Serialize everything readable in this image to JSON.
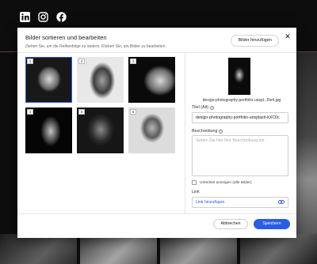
{
  "social": [
    {
      "icon": "linkedin-icon"
    },
    {
      "icon": "instagram-icon"
    },
    {
      "icon": "facebook-icon"
    }
  ],
  "modal": {
    "title": "Bilder sortieren und bearbeiten",
    "subtitle": "Ziehen Sie, um die Reihenfolge zu ändern. Klicken Sie, um Bilder zu bearbeiten.",
    "add_label": "Bilder hinzufügen",
    "close_label": "✕"
  },
  "thumbnails": [
    {
      "num": "1",
      "selected": true
    },
    {
      "num": "2",
      "selected": false
    },
    {
      "num": "3",
      "selected": false
    },
    {
      "num": "4",
      "selected": false
    },
    {
      "num": "5",
      "selected": false
    },
    {
      "num": "6",
      "selected": false
    }
  ],
  "details": {
    "filename": "design-photography-portfolio-unspl...Re4.jpg",
    "title_label": "Titel (Alt)",
    "title_value": "design-photography-portfolio-unsplash-kXC0c",
    "description_label": "Beschreibung",
    "description_placeholder": "Geben Sie hier Ihre Beschreibung ein",
    "caption_checkbox_label": "Untertitel anzeigen (alle Bilder)",
    "link_label": "Link",
    "link_placeholder": "Link hinzufügen"
  },
  "footer": {
    "cancel_label": "Abbrechen",
    "save_label": "Speichern"
  },
  "colors": {
    "accent": "#2b5ce6",
    "background": "#0d0d0d"
  }
}
